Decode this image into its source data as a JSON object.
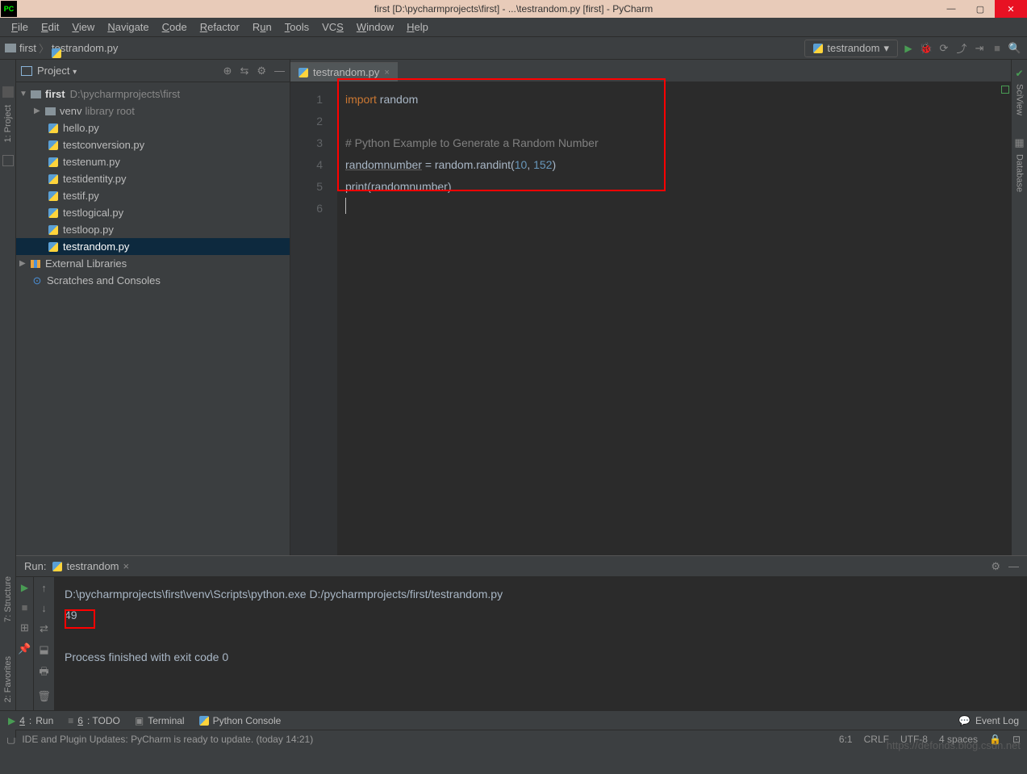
{
  "window": {
    "title": "first [D:\\pycharmprojects\\first] - ...\\testrandom.py [first] - PyCharm",
    "minimize": "—",
    "maximize": "▢",
    "close": "✕",
    "pc": "PC"
  },
  "menu": {
    "file": "File",
    "edit": "Edit",
    "view": "View",
    "navigate": "Navigate",
    "code": "Code",
    "refactor": "Refactor",
    "run": "Run",
    "tools": "Tools",
    "vcs": "VCS",
    "window": "Window",
    "help": "Help"
  },
  "breadcrumb": {
    "project": "first",
    "file": "testrandom.py"
  },
  "run_config": {
    "name": "testrandom",
    "arrow": "▾"
  },
  "left_gutter": {
    "project": "1: Project"
  },
  "project_panel": {
    "title": "Project",
    "arrow": "▾",
    "root": {
      "name": "first",
      "path": "D:\\pycharmprojects\\first"
    },
    "venv": {
      "name": "venv",
      "suffix": "library root"
    },
    "files": [
      "hello.py",
      "testconversion.py",
      "testenum.py",
      "testidentity.py",
      "testif.py",
      "testlogical.py",
      "testloop.py",
      "testrandom.py"
    ],
    "ext_lib": "External Libraries",
    "scratches": "Scratches and Consoles"
  },
  "editor": {
    "tab": "testrandom.py",
    "lines": [
      "1",
      "2",
      "3",
      "4",
      "5",
      "6"
    ],
    "code": {
      "l1": {
        "kw": "import",
        "id": "random"
      },
      "l3": "# Python Example to Generate a Random Number",
      "l4": {
        "a": "randomnumber",
        "b": " = random.randint(",
        "n1": "10",
        "c": ", ",
        "n2": "152",
        "d": ")"
      },
      "l5": {
        "a": "print",
        "b": "(randomnumber)"
      }
    }
  },
  "right_gutter": {
    "sciview": "SciView",
    "database": "Database"
  },
  "run_panel": {
    "label": "Run:",
    "tab": "testrandom",
    "cmd": "D:\\pycharmprojects\\first\\venv\\Scripts\\python.exe D:/pycharmprojects/first/testrandom.py",
    "output": "49",
    "exit": "Process finished with exit code 0"
  },
  "bottom_left": {
    "structure": "7: Structure",
    "favorites": "2: Favorites"
  },
  "bottom_tabs": {
    "run": "4: Run",
    "todo": "6: TODO",
    "terminal": "Terminal",
    "python_console": "Python Console",
    "event_log": "Event Log"
  },
  "status": {
    "msg": "IDE and Plugin Updates: PyCharm is ready to update. (today 14:21)",
    "pos": "6:1",
    "crlf": "CRLF",
    "enc": "UTF-8",
    "indent": "4 spaces",
    "lock": "🔒"
  },
  "watermark": "https://defonds.blog.csdn.net"
}
